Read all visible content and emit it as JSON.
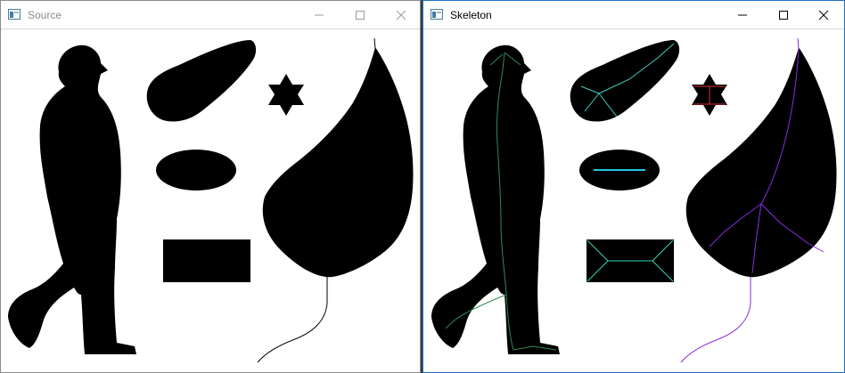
{
  "windows": {
    "source": {
      "title": "Source"
    },
    "skeleton": {
      "title": "Skeleton"
    }
  },
  "icons": {
    "app": "window-app-icon",
    "minimize": "minimize-icon",
    "maximize": "maximize-icon",
    "close": "close-icon"
  },
  "colors": {
    "shape_fill": "#000000",
    "canvas_bg": "#ffffff",
    "skeleton_person": "#2e8b57",
    "skeleton_teardrop": "#40d0c0",
    "skeleton_star": "#e03030",
    "skeleton_ellipse": "#20c8e0",
    "skeleton_rectangle": "#30d8b8",
    "skeleton_leaf": "#8a2be2",
    "active_border": "#1a73c8"
  }
}
